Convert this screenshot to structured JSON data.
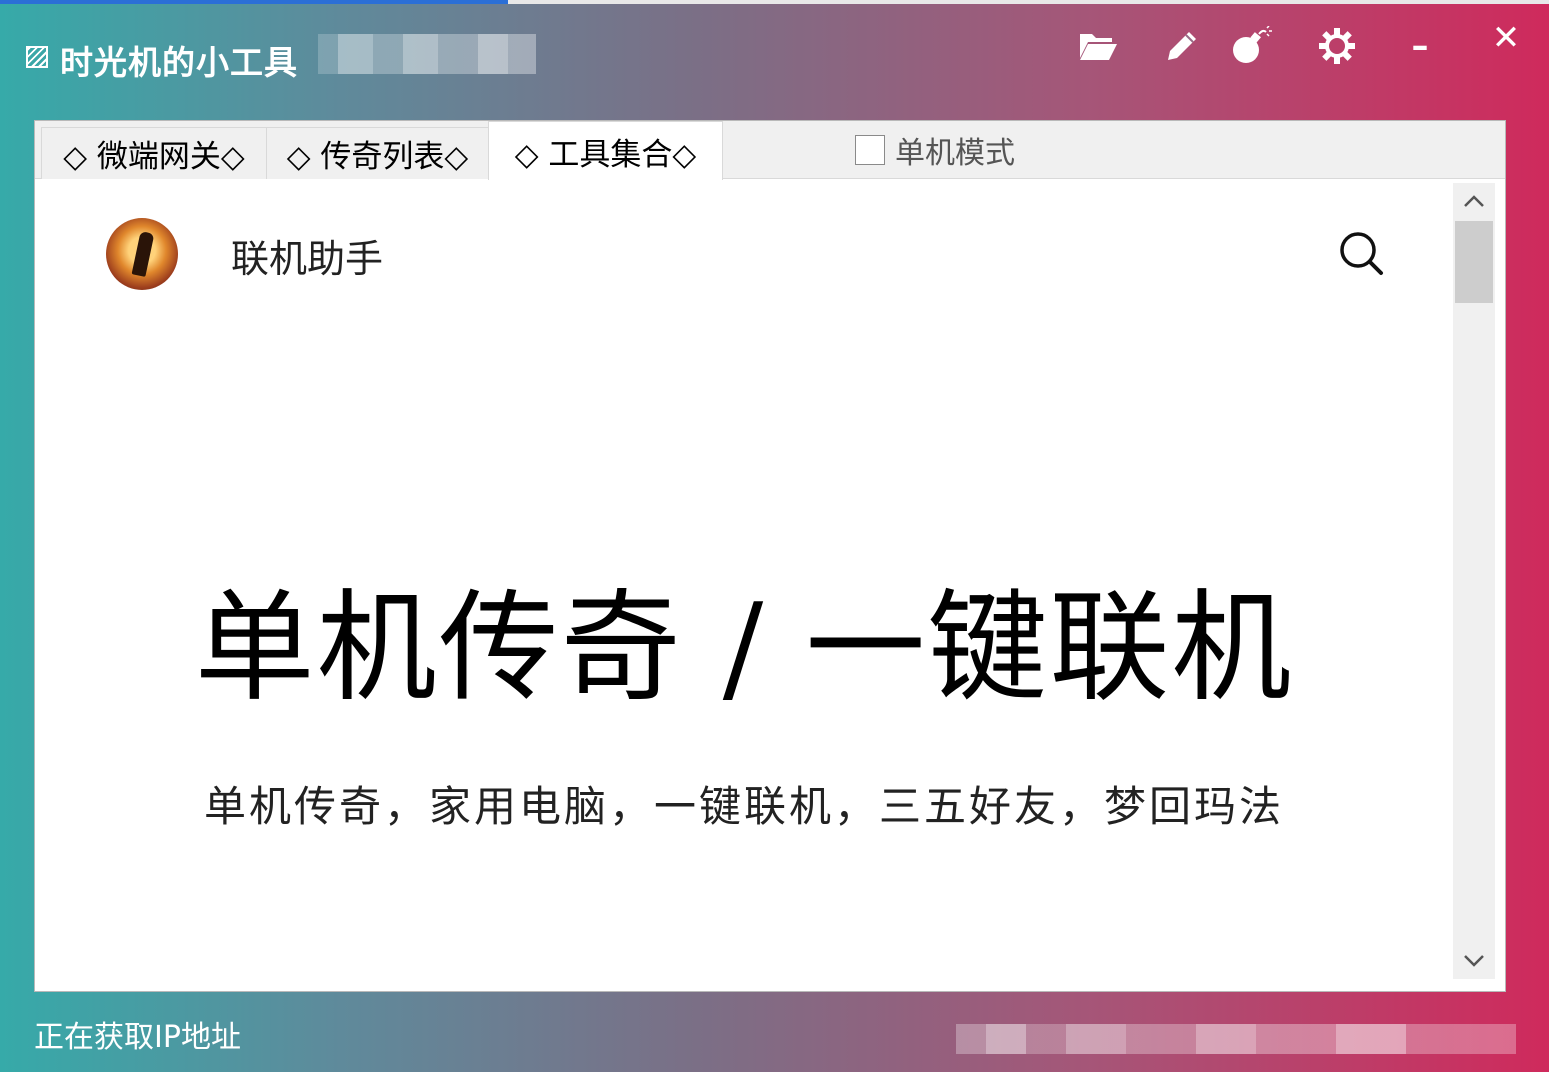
{
  "window": {
    "title": "时光机的小工具",
    "controls": {
      "open_icon": "folder-open-icon",
      "edit_icon": "pencil-icon",
      "bomb_icon": "bomb-icon",
      "settings_icon": "gear-icon",
      "minimize_label": "–",
      "close_label": "✕"
    }
  },
  "tabs": [
    {
      "label": "◇ 微端网关◇",
      "active": false
    },
    {
      "label": "◇ 传奇列表◇",
      "active": false
    },
    {
      "label": "◇ 工具集合◇",
      "active": true
    }
  ],
  "standalone_mode": {
    "label": "单机模式",
    "checked": false
  },
  "web": {
    "site_name": "联机助手",
    "hero_title": "单机传奇 / 一键联机",
    "hero_subtitle": "单机传奇，家用电脑，一键联机，三五好友，梦回玛法"
  },
  "status_bar": {
    "text": "正在获取IP地址"
  },
  "colors": {
    "gradient_start": "#36aaa9",
    "gradient_end": "#cf2a5c",
    "tab_bg": "#f0f0f0"
  }
}
